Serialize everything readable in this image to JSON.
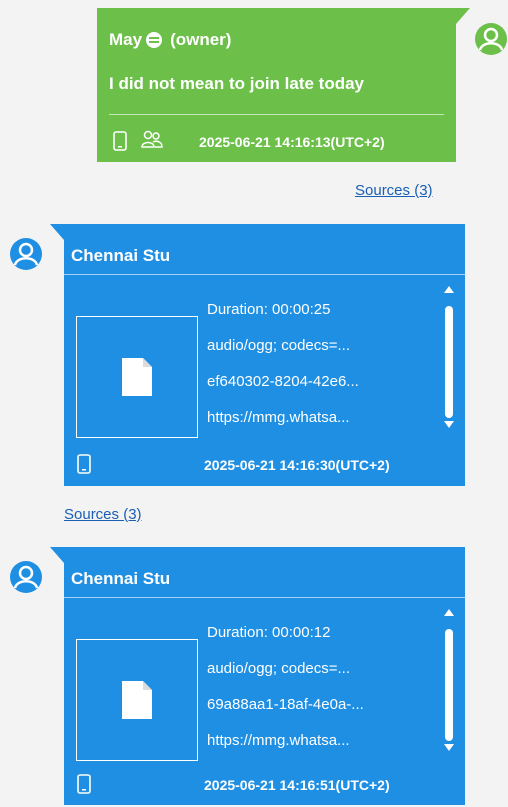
{
  "messages": [
    {
      "sender": "May",
      "role": "(owner)",
      "text": "I did not mean to join late today",
      "timestamp": "2025-06-21 14:16:13(UTC+2)",
      "sources": "Sources (3)",
      "color": "#6cc04a"
    },
    {
      "sender": "Chennai Stu",
      "attachment": {
        "duration": "Duration: 00:00:25",
        "mime": "audio/ogg; codecs=...",
        "id": "ef640302-8204-42e6...",
        "url": "https://mmg.whatsa..."
      },
      "timestamp": "2025-06-21 14:16:30(UTC+2)",
      "sources": "Sources (3)",
      "color": "#1e8fe3"
    },
    {
      "sender": "Chennai Stu",
      "attachment": {
        "duration": "Duration: 00:00:12",
        "mime": "audio/ogg; codecs=...",
        "id": "69a88aa1-18af-4e0a-...",
        "url": "https://mmg.whatsa..."
      },
      "timestamp": "2025-06-21 14:16:51(UTC+2)",
      "color": "#1e8fe3"
    }
  ],
  "icons": [
    "user-avatar-icon",
    "emoji-icon",
    "phone-icon",
    "group-icon",
    "file-icon",
    "scroll-up-icon",
    "scroll-down-icon"
  ]
}
